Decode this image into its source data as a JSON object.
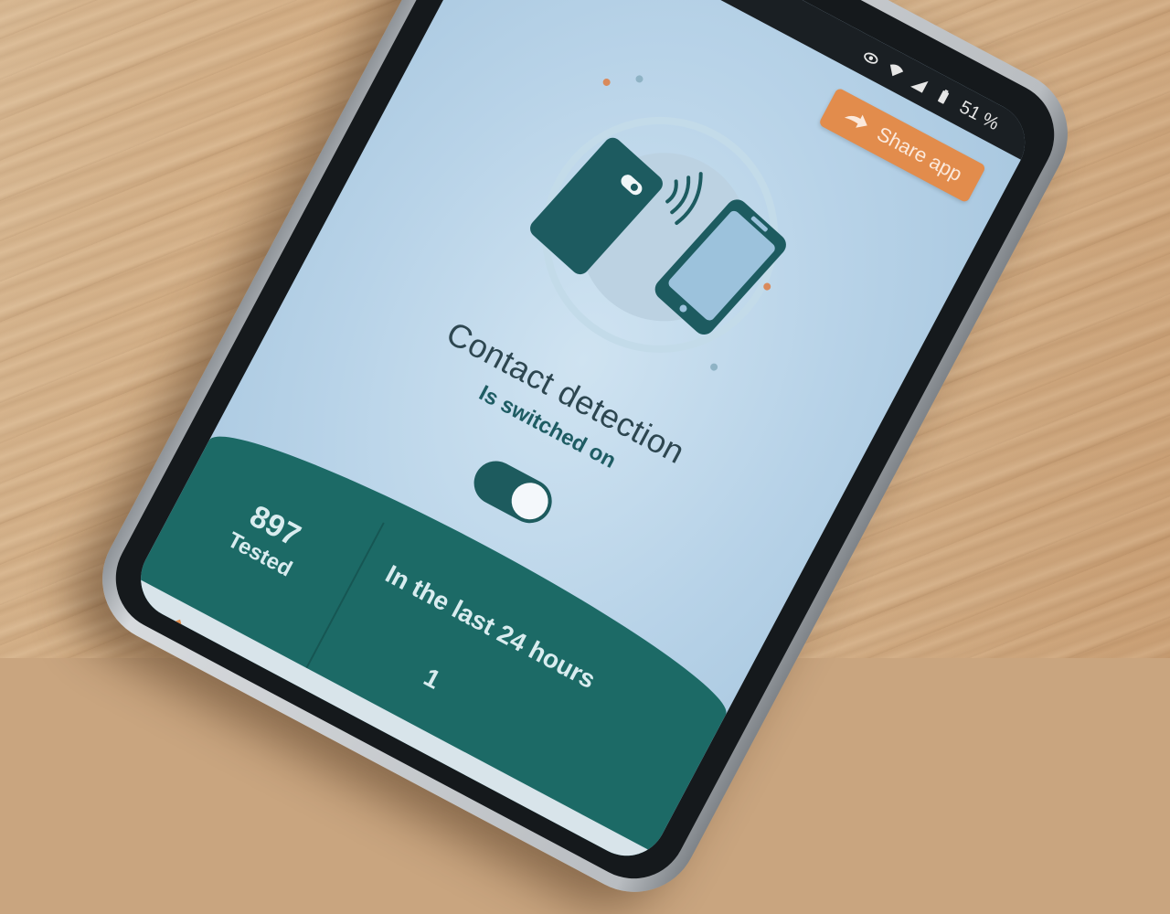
{
  "status_bar": {
    "battery": "51 %"
  },
  "header": {
    "share_button_label": "Share app"
  },
  "main": {
    "title": "Contact detection",
    "subtitle": "Is switched on",
    "toggle_on": true
  },
  "stats": {
    "tested_value": "897",
    "tested_label": "Tested",
    "period_label": "In the last 24 hours",
    "second_value": "1"
  },
  "colors": {
    "accent": "#e28c4c",
    "primary": "#1c6a66",
    "screen_background": "#b8d3e8"
  },
  "icons": [
    "eye-icon",
    "wifi-icon",
    "signal-icon",
    "battery-icon",
    "arrow-right-icon",
    "phone-icon",
    "contactless-waves-icon"
  ]
}
